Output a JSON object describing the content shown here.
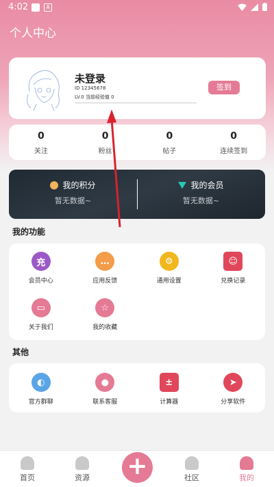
{
  "status_bar": {
    "time": "4:02",
    "notif_icon": "A"
  },
  "header": {
    "title": "个人中心"
  },
  "profile": {
    "username": "未登录",
    "id_text": "ID  12345678",
    "level_text": "LV.0   当前经验值   0",
    "signin_label": "签到"
  },
  "stats": [
    {
      "value": "0",
      "label": "关注"
    },
    {
      "value": "0",
      "label": "粉丝"
    },
    {
      "value": "0",
      "label": "帖子"
    },
    {
      "value": "0",
      "label": "连续签到"
    }
  ],
  "points": {
    "title": "我的积分",
    "subtitle": "暂无数据~"
  },
  "membership": {
    "title": "我的会员",
    "subtitle": "暂无数据~"
  },
  "functions": {
    "title": "我的功能",
    "items": [
      {
        "label": "会员中心",
        "glyph": "充",
        "color": "#9b59c6",
        "icon": "recharge-icon"
      },
      {
        "label": "应用反馈",
        "glyph": "…",
        "color": "#f39c4a",
        "icon": "feedback-icon"
      },
      {
        "label": "通用设置",
        "glyph": "⚙",
        "color": "#f2b71e",
        "icon": "gear-icon"
      },
      {
        "label": "兑换记录",
        "glyph": "☺",
        "color": "#e0475a",
        "icon": "exchange-icon"
      },
      {
        "label": "关于我们",
        "glyph": "▭",
        "color": "#e57a95",
        "icon": "about-icon"
      },
      {
        "label": "我的收藏",
        "glyph": "☆",
        "color": "#e57a95",
        "icon": "star-icon"
      }
    ]
  },
  "others": {
    "title": "其他",
    "items": [
      {
        "label": "官方群聊",
        "glyph": "◐",
        "color": "#5aa5e6",
        "icon": "group-chat-icon"
      },
      {
        "label": "联系客服",
        "glyph": "●",
        "color": "#e57a95",
        "icon": "customer-service-icon"
      },
      {
        "label": "计算器",
        "glyph": "±",
        "color": "#e0475a",
        "icon": "calculator-icon"
      },
      {
        "label": "分享软件",
        "glyph": "➤",
        "color": "#e0475a",
        "icon": "share-icon"
      }
    ]
  },
  "tabbar": {
    "items": [
      {
        "label": "首页"
      },
      {
        "label": "资源"
      },
      {
        "label": "社区"
      },
      {
        "label": "我的"
      }
    ]
  },
  "colors": {
    "accent": "#e57a95",
    "dark_card": "#2a333c"
  }
}
